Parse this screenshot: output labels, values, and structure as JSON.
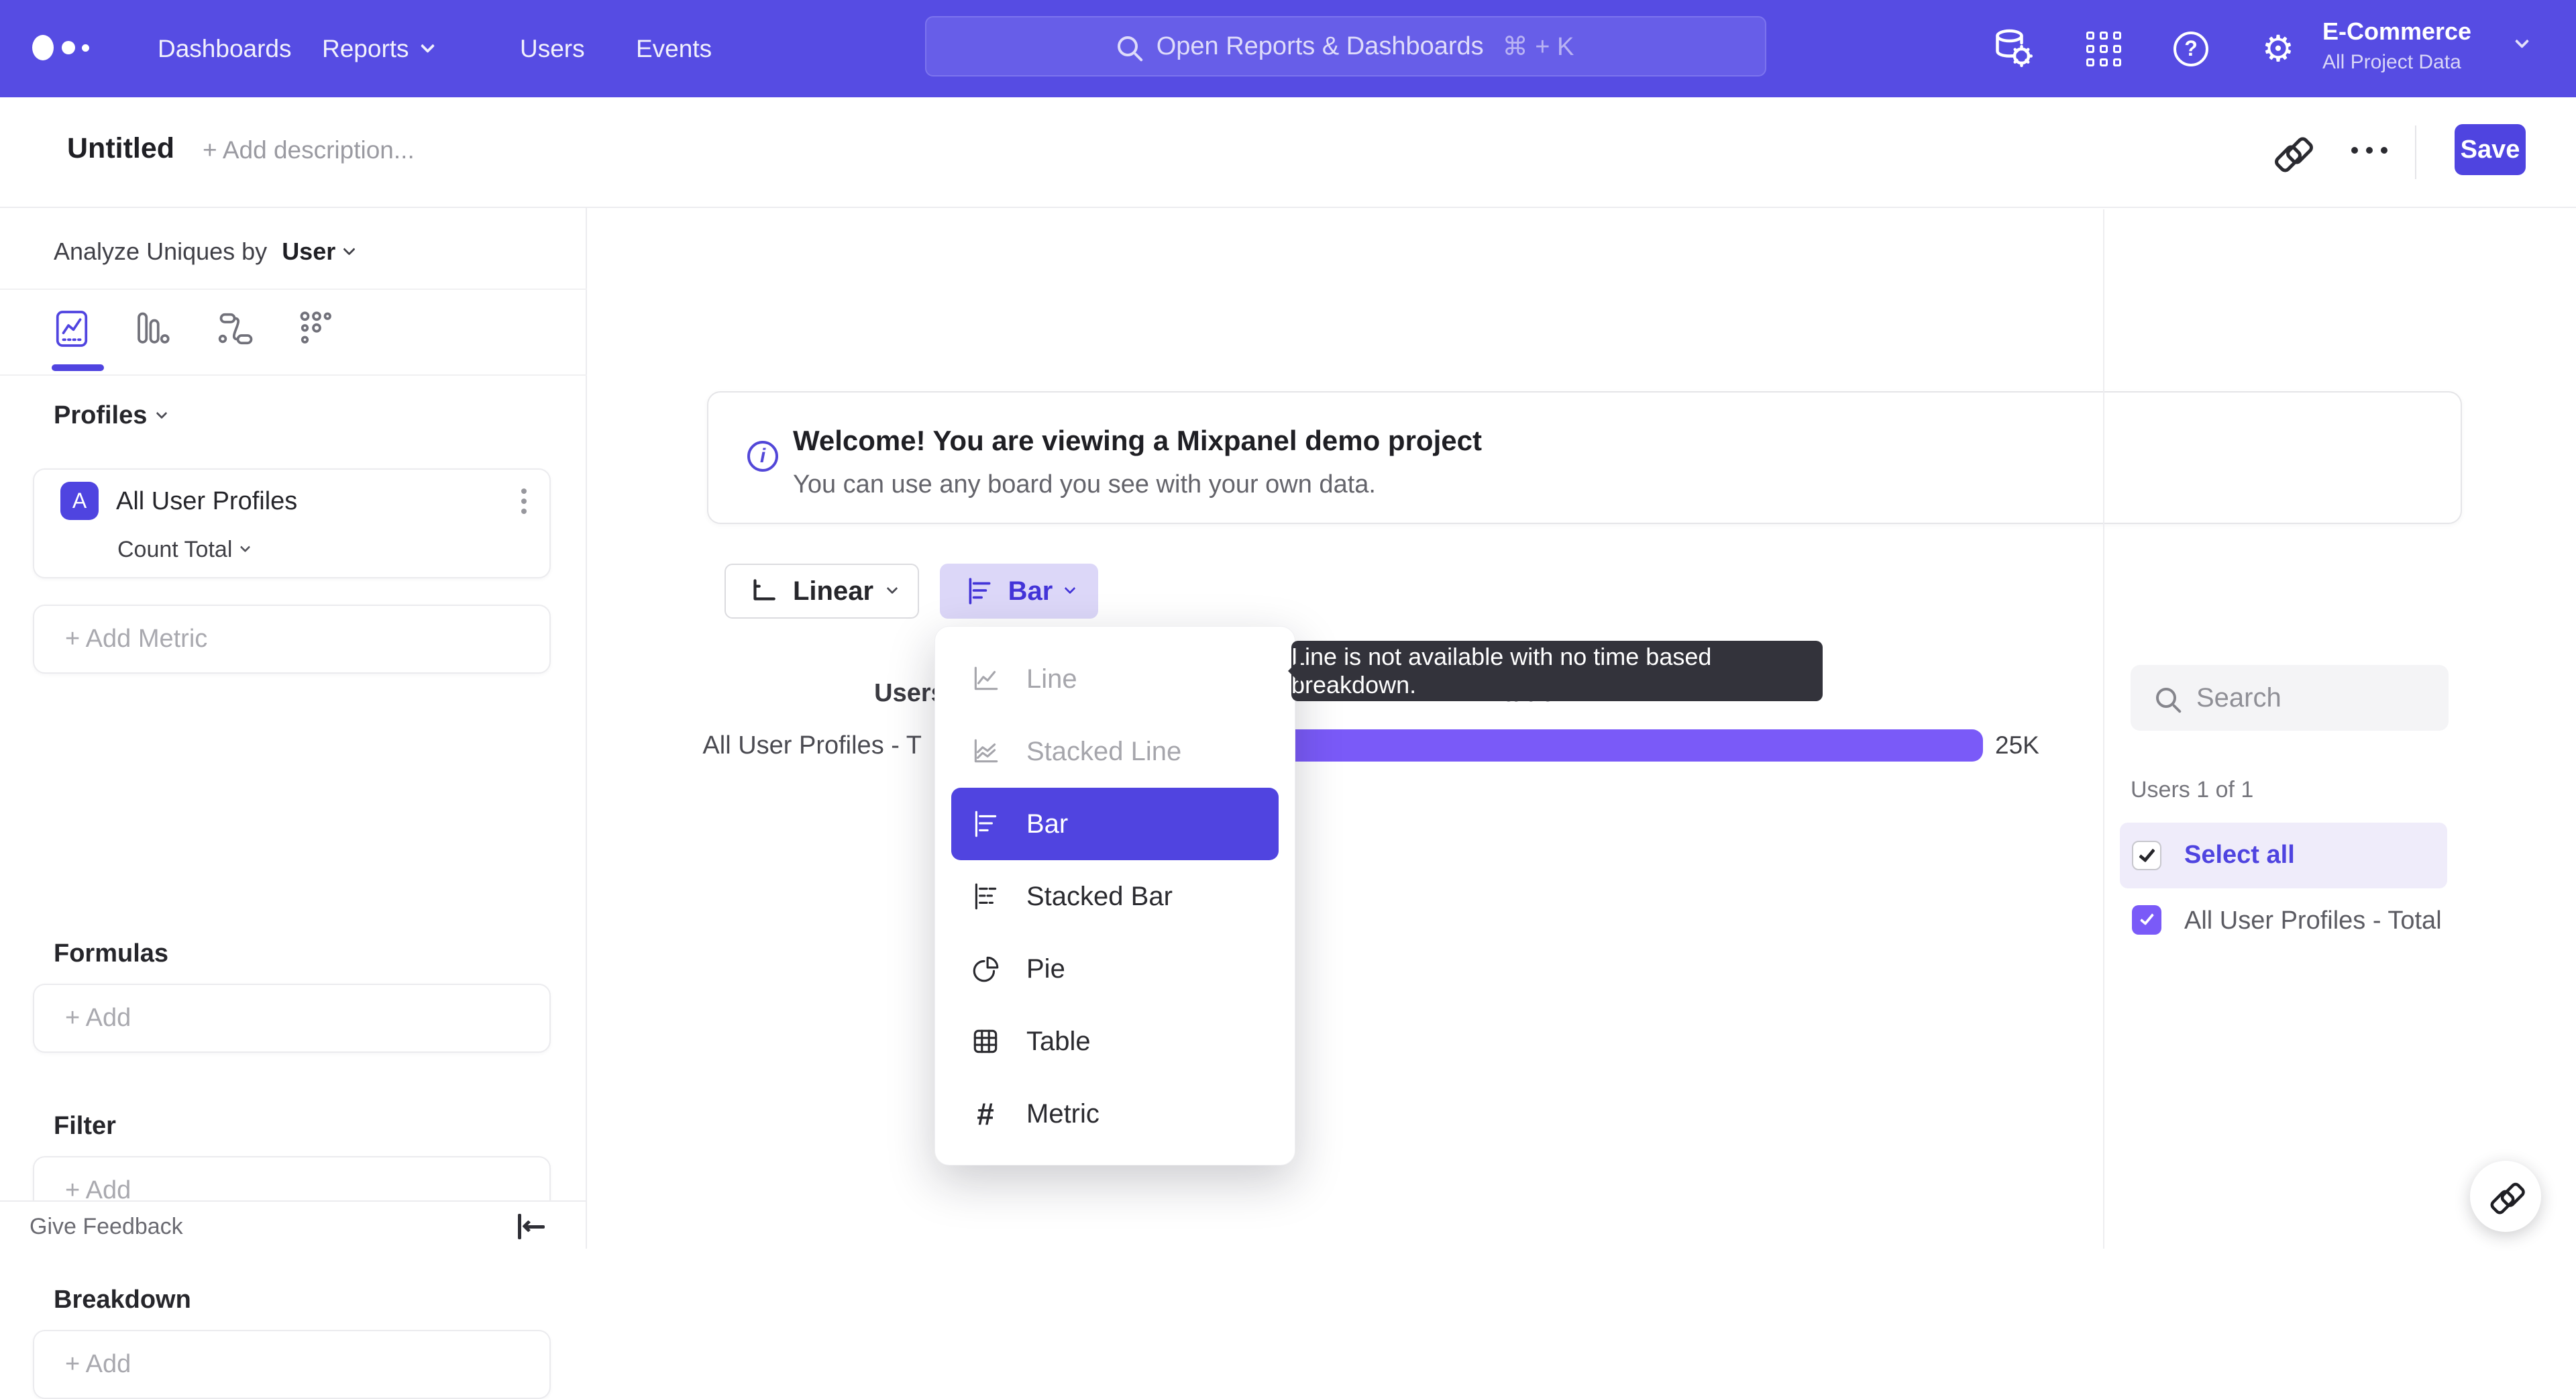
{
  "topnav": {
    "items": [
      "Dashboards",
      "Reports",
      "Users",
      "Events"
    ],
    "search_placeholder": "Open Reports & Dashboards",
    "search_shortcut": "⌘ + K",
    "project_name": "E-Commerce",
    "project_scope": "All Project Data"
  },
  "titlebar": {
    "title": "Untitled",
    "add_description": "+ Add description...",
    "save_label": "Save"
  },
  "sidebar": {
    "analyze_prefix": "Analyze Uniques by",
    "analyze_value": "User",
    "profiles_header": "Profiles",
    "metric_badge": "A",
    "metric_name": "All User Profiles",
    "aggregation": "Count Total",
    "add_metric": "+ Add Metric",
    "formulas_label": "Formulas",
    "formulas_add": "+ Add",
    "filter_label": "Filter",
    "filter_add": "+ Add",
    "breakdown_label": "Breakdown",
    "breakdown_add": "+ Add",
    "feedback": "Give Feedback"
  },
  "banner": {
    "title": "Welcome! You are viewing a Mixpanel demo project",
    "subtitle": "You can use any board you see with your own data."
  },
  "controls": {
    "scale": "Linear",
    "chart_type": "Bar"
  },
  "dropdown": {
    "items": [
      {
        "label": "Line",
        "state": "disabled"
      },
      {
        "label": "Stacked Line",
        "state": "disabled"
      },
      {
        "label": "Bar",
        "state": "selected"
      },
      {
        "label": "Stacked Bar",
        "state": "normal"
      },
      {
        "label": "Pie",
        "state": "normal"
      },
      {
        "label": "Table",
        "state": "normal"
      },
      {
        "label": "Metric",
        "state": "normal"
      }
    ]
  },
  "tooltip": {
    "text": "Line is not available with no time based breakdown."
  },
  "chart": {
    "col_users": "Users",
    "col_value": "Value",
    "row_label": "All User Profiles - T",
    "value_label": "25K"
  },
  "chart_data": {
    "type": "bar",
    "orientation": "horizontal",
    "categories": [
      "All User Profiles - Total"
    ],
    "values": [
      25000
    ],
    "value_labels": [
      "25K"
    ],
    "title": "",
    "xlabel": "Value",
    "ylabel": "Users",
    "bar_color": "#7A5AF8"
  },
  "right_panel": {
    "search_placeholder": "Search",
    "count": "Users 1 of 1",
    "select_all": "Select all",
    "series_label": "All User Profiles - Total"
  },
  "colors": {
    "nav_purple": "#564CE3",
    "accent": "#4F44E0",
    "bar_fill": "#7A5AF8",
    "tooltip_bg": "#33333B",
    "selected_row_bg": "#EFECFA"
  }
}
